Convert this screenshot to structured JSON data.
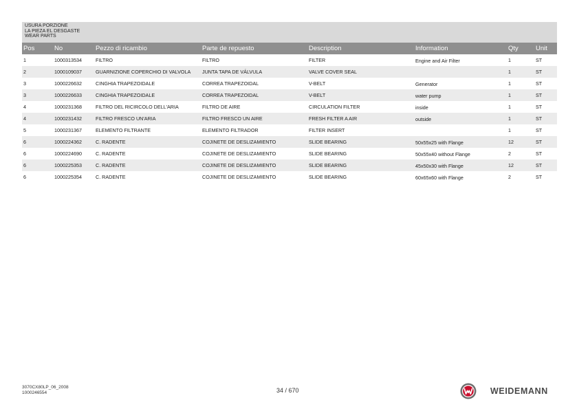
{
  "section": {
    "lines": [
      "USURA PORZIONE",
      "LA PIEZA EL DESGASTE",
      "WEAR PARTS"
    ]
  },
  "table": {
    "headers": {
      "pos": "Pos",
      "no": "No",
      "pezzo": "Pezzo di ricambio",
      "parte": "Parte de repuesto",
      "description": "Description",
      "information": "Information",
      "qty": "Qty",
      "unit": "Unit"
    },
    "rows": [
      {
        "pos": "1",
        "no": "1000313534",
        "pezzo": "FILTRO",
        "parte": "FILTRO",
        "description": "FILTER",
        "information": "Engine and Air Filter",
        "qty": "1",
        "unit": "ST"
      },
      {
        "pos": "2",
        "no": "1000109037",
        "pezzo": "GUARNIZIONE COPERCHIO DI VALVOLA",
        "parte": "JUNTA TAPA DE VÁLVULA",
        "description": "VALVE COVER SEAL",
        "information": "",
        "qty": "1",
        "unit": "ST"
      },
      {
        "pos": "3",
        "no": "1000226632",
        "pezzo": "CINGHIA TRAPEZOIDALE",
        "parte": "CORREA TRAPEZOIDAL",
        "description": "V-BELT",
        "information": "Generator",
        "qty": "1",
        "unit": "ST"
      },
      {
        "pos": "3",
        "no": "1000226633",
        "pezzo": "CINGHIA TRAPEZOIDALE",
        "parte": "CORREA TRAPEZOIDAL",
        "description": "V-BELT",
        "information": "water pump",
        "qty": "1",
        "unit": "ST"
      },
      {
        "pos": "4",
        "no": "1000231368",
        "pezzo": "FILTRO DEL RICIRCOLO DELL'ARIA",
        "parte": "FILTRO DE AIRE",
        "description": "CIRCULATION FILTER",
        "information": "inside",
        "qty": "1",
        "unit": "ST"
      },
      {
        "pos": "4",
        "no": "1000231432",
        "pezzo": "FILTRO FRESCO UN'ARIA",
        "parte": "FILTRO FRESCO UN AIRE",
        "description": "FRESH FILTER A AIR",
        "information": "outside",
        "qty": "1",
        "unit": "ST"
      },
      {
        "pos": "5",
        "no": "1000231367",
        "pezzo": "ELEMENTO FILTRANTE",
        "parte": "ELEMENTO FILTRADOR",
        "description": "FILTER INSERT",
        "information": "",
        "qty": "1",
        "unit": "ST"
      },
      {
        "pos": "6",
        "no": "1000224362",
        "pezzo": "C. RADENTE",
        "parte": "COJINETE DE DESLIZAMIENTO",
        "description": "SLIDE BEARING",
        "information": "50x55x25 with Flange",
        "qty": "12",
        "unit": "ST"
      },
      {
        "pos": "6",
        "no": "1000224690",
        "pezzo": "C. RADENTE",
        "parte": "COJINETE DE DESLIZAMIENTO",
        "description": "SLIDE BEARING",
        "information": "50x55x40 without Flange",
        "qty": "2",
        "unit": "ST"
      },
      {
        "pos": "6",
        "no": "1000225353",
        "pezzo": "C. RADENTE",
        "parte": "COJINETE DE DESLIZAMIENTO",
        "description": "SLIDE BEARING",
        "information": "45x50x30 with Flange",
        "qty": "12",
        "unit": "ST"
      },
      {
        "pos": "6",
        "no": "1000225354",
        "pezzo": "C. RADENTE",
        "parte": "COJINETE DE DESLIZAMIENTO",
        "description": "SLIDE BEARING",
        "information": "60x65x60 with Flange",
        "qty": "2",
        "unit": "ST"
      }
    ]
  },
  "footer": {
    "doc_code": "3070CX80LP_06_2008",
    "doc_number": "1000246554",
    "page_number": "34 / 670",
    "brand_name": "WEIDEMANN"
  },
  "colors": {
    "header_bar": "#d9d9d9",
    "table_header": "#8f8f8f",
    "row_alt": "#ebebeb",
    "logo_red": "#c8102e",
    "logo_gray": "#6d6d6d"
  },
  "icons": {
    "brand_logo": "weidemann-logo-icon"
  }
}
